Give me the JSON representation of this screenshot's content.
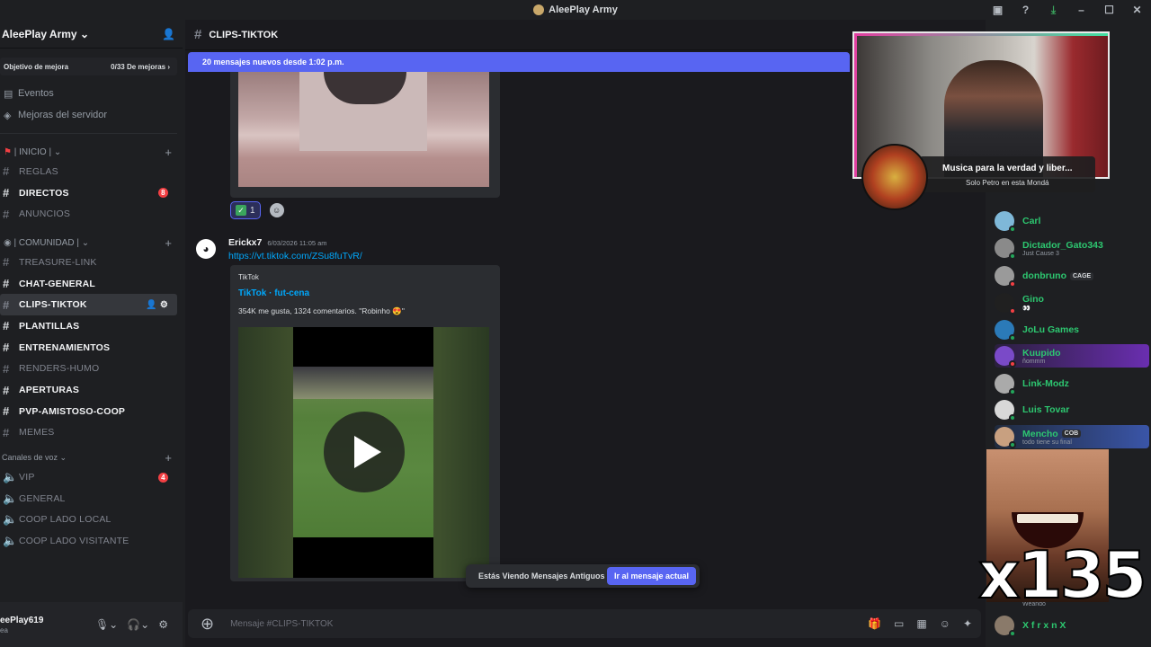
{
  "window": {
    "title": "AleePlay Army"
  },
  "server": {
    "name": "AleePlay Army",
    "boost_label": "Objetivo de mejora",
    "boost_progress": "0/33 De mejoras",
    "events": "Eventos",
    "upgrades": "Mejoras del servidor"
  },
  "categories": {
    "inicio": "| INICIO |",
    "comunidad": "| COMUNIDAD |",
    "voice": "Canales de voz"
  },
  "channels_inicio": [
    {
      "name": "REGLAS",
      "unread": false
    },
    {
      "name": "DIRECTOS",
      "unread": true,
      "badge": "8"
    },
    {
      "name": "ANUNCIOS",
      "unread": false
    }
  ],
  "channels_comunidad": [
    {
      "name": "TREASURE-LINK"
    },
    {
      "name": "CHAT-GENERAL"
    },
    {
      "name": "CLIPS-TIKTOK"
    },
    {
      "name": "PLANTILLAS"
    },
    {
      "name": "ENTRENAMIENTOS"
    },
    {
      "name": "RENDERS-HUMO"
    },
    {
      "name": "APERTURAS"
    },
    {
      "name": "PVP-AMISTOSO-COOP"
    },
    {
      "name": "MEMES"
    }
  ],
  "voice_channels": [
    {
      "name": "VIP",
      "badge": "4"
    },
    {
      "name": "GENERAL"
    },
    {
      "name": "COOP LADO LOCAL"
    },
    {
      "name": "COOP LADO VISITANTE"
    }
  ],
  "user": {
    "name": "eePlay619",
    "status": "ea"
  },
  "chat": {
    "channel": "CLIPS-TIKTOK",
    "new_messages": "20 mensajes nuevos desde 1:02 p.m.",
    "reaction_count": "1",
    "message": {
      "author": "Erickx7",
      "timestamp": "6/03/2026 11:05 am",
      "link": "https://vt.tiktok.com/ZSu8fuTvR/",
      "embed_provider": "TikTok",
      "embed_title": "TikTok · fut-cena",
      "embed_desc": "354K me gusta, 1324 comentarios. \"Robinho 😍\""
    },
    "old_notice": "Estás Viendo Mensajes Antiguos",
    "jump_label": "Ir al mensaje actual",
    "composer_placeholder": "Mensaje #CLIPS-TIKTOK"
  },
  "members": [
    {
      "name": "Carl",
      "sub": ""
    },
    {
      "name": "Dictador_Gato343",
      "sub": "Just Cause 3"
    },
    {
      "name": "donbruno",
      "sub": "",
      "tag": "CAGE"
    },
    {
      "name": "Gino",
      "sub": "👀"
    },
    {
      "name": "JoLu Games",
      "sub": ""
    },
    {
      "name": "Kuupido",
      "sub": "ñommm"
    },
    {
      "name": "Link-Modz",
      "sub": ""
    },
    {
      "name": "Luis Tovar",
      "sub": ""
    },
    {
      "name": "Mencho",
      "sub": "todo tiene su final",
      "tag": "COB"
    },
    {
      "name": "X f r x n X",
      "sub": ""
    }
  ],
  "overlay": {
    "song": "Musica para la verdad y liber...",
    "artist": "Solo Petro en esta Mondá",
    "counter": "x135",
    "partial_sub": "Weando"
  }
}
